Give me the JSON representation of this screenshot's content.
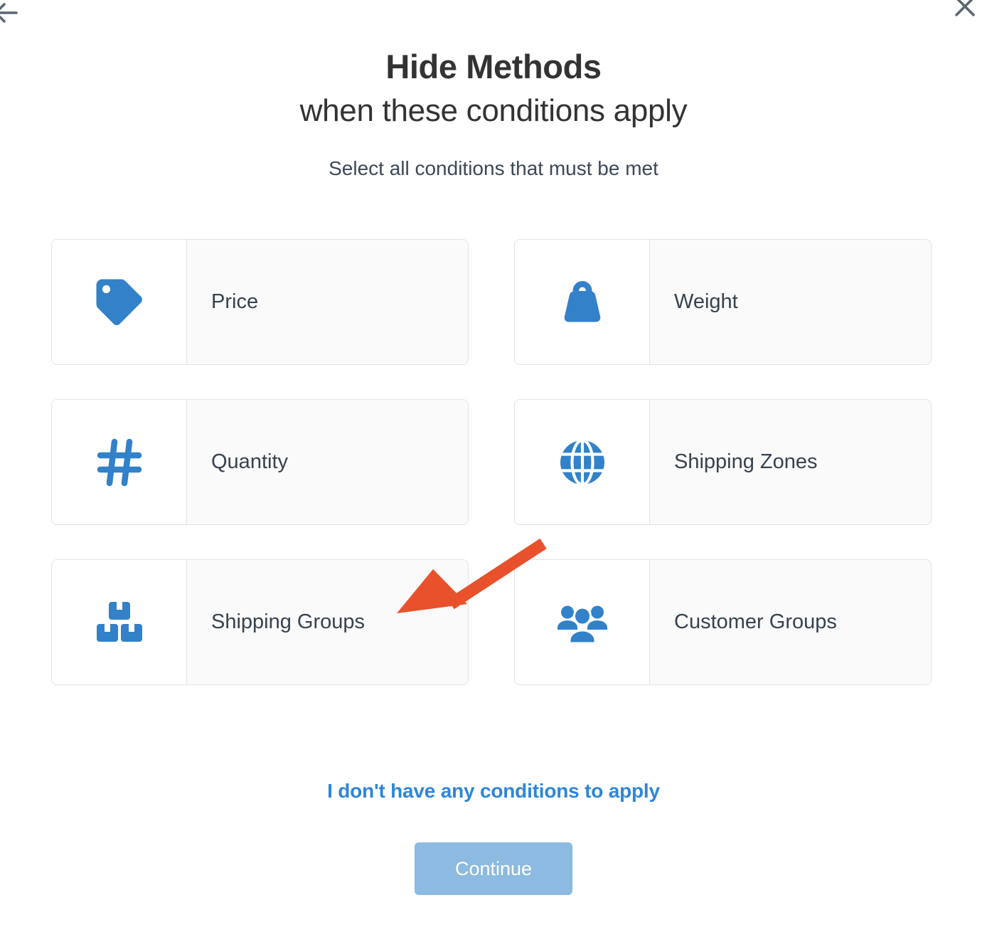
{
  "nav": {
    "back_icon": "back-arrow-icon",
    "close_icon": "close-icon"
  },
  "header": {
    "title_line1": "Hide Methods",
    "title_line2": "when these conditions apply",
    "subtitle": "Select all conditions that must be met"
  },
  "conditions": [
    {
      "label": "Price",
      "icon": "price-tag-icon"
    },
    {
      "label": "Weight",
      "icon": "weight-icon"
    },
    {
      "label": "Quantity",
      "icon": "hash-icon"
    },
    {
      "label": "Shipping Zones",
      "icon": "globe-icon"
    },
    {
      "label": "Shipping Groups",
      "icon": "boxes-icon"
    },
    {
      "label": "Customer Groups",
      "icon": "people-group-icon"
    }
  ],
  "footer": {
    "no_conditions_link": "I don't have any conditions to apply",
    "continue_label": "Continue"
  },
  "annotation": {
    "type": "arrow",
    "points_to": "Shipping Groups",
    "color": "#e8512b"
  },
  "colors": {
    "icon_blue": "#3281c9",
    "link_blue": "#2e86d8",
    "button_blue": "#8cbae0",
    "annotation_red": "#e8512b",
    "card_border": "#e3e3e3",
    "card_label_bg": "#fafafa",
    "title_text": "#333333",
    "body_text": "#3c4858"
  }
}
